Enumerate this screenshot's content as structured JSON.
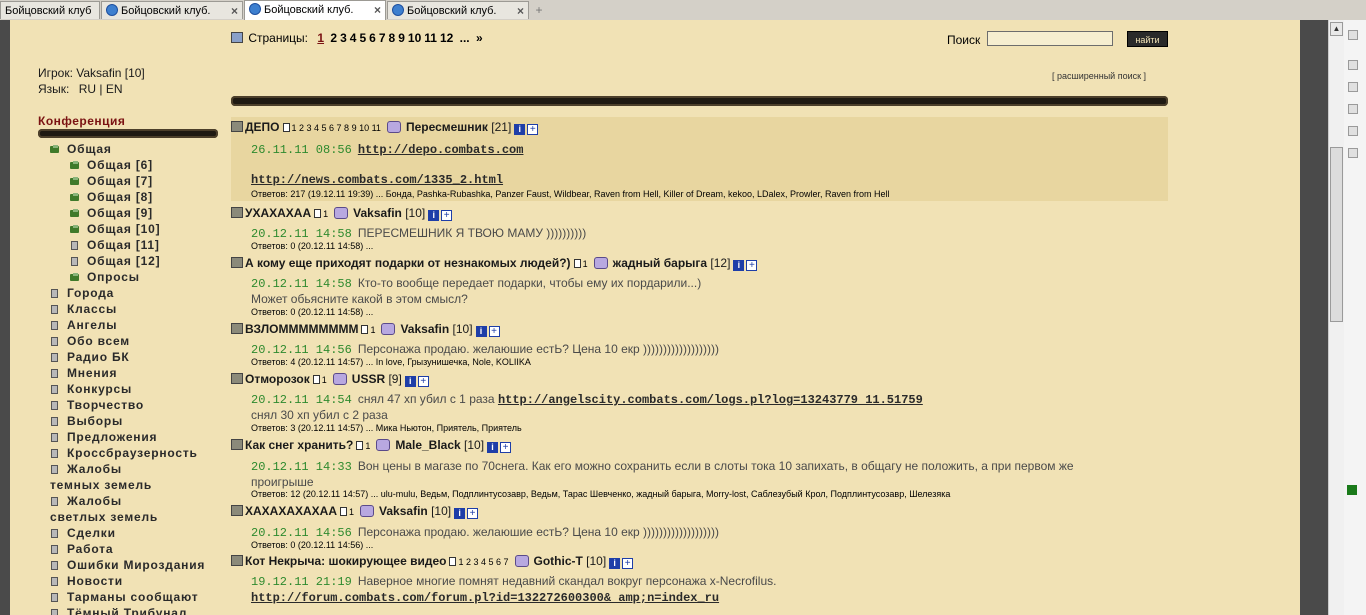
{
  "browser": {
    "tabs": [
      {
        "title": "Бойцовский клуб"
      },
      {
        "title": "Бойцовский клуб."
      },
      {
        "title": "Бойцовский клуб."
      },
      {
        "title": "Бойцовский клуб."
      }
    ],
    "new_tab": "+"
  },
  "player": {
    "label": "Игрок: Vaksafin [10]",
    "lang_label": "Язык:",
    "lang_ru": "RU",
    "lang_sep": "|",
    "lang_en": "EN"
  },
  "sidebar": {
    "title": "Конференция",
    "items": [
      {
        "label": "Общая",
        "icon": "folder-icon"
      },
      {
        "label": "Общая [6]",
        "icon": "folder-icon"
      },
      {
        "label": "Общая [7]",
        "icon": "folder-icon"
      },
      {
        "label": "Общая [8]",
        "icon": "folder-icon"
      },
      {
        "label": "Общая [9]",
        "icon": "folder-icon"
      },
      {
        "label": "Общая [10]",
        "icon": "folder-icon"
      },
      {
        "label": "Общая [11]",
        "icon": "scroll-icon"
      },
      {
        "label": "Общая [12]",
        "icon": "scroll-icon"
      },
      {
        "label": "Опросы",
        "icon": "folder-icon"
      },
      {
        "label": "Города",
        "icon": "scroll-icon"
      },
      {
        "label": "Классы",
        "icon": "scroll-icon"
      },
      {
        "label": "Ангелы",
        "icon": "scroll-icon"
      },
      {
        "label": "Обо всем",
        "icon": "scroll-icon"
      },
      {
        "label": "Радио БК",
        "icon": "scroll-icon"
      },
      {
        "label": "Мнения",
        "icon": "scroll-icon"
      },
      {
        "label": "Конкурсы",
        "icon": "scroll-icon"
      },
      {
        "label": "Творчество",
        "icon": "scroll-icon"
      },
      {
        "label": "Выборы",
        "icon": "scroll-icon"
      },
      {
        "label": "Предложения",
        "icon": "scroll-icon"
      },
      {
        "label": "Кроссбраузерность",
        "icon": "scroll-icon"
      },
      {
        "label": "Жалобы",
        "label2": "темных земель",
        "icon": "scroll-icon"
      },
      {
        "label": "Жалобы",
        "label2": "светлых земель",
        "icon": "scroll-icon"
      },
      {
        "label": "Сделки",
        "icon": "scroll-icon"
      },
      {
        "label": "Работа",
        "icon": "scroll-icon"
      },
      {
        "label": "Ошибки Мироздания",
        "icon": "scroll-icon"
      },
      {
        "label": "Новости",
        "icon": "scroll-icon"
      },
      {
        "label": "Тарманы сообщают",
        "icon": "scroll-icon"
      },
      {
        "label": "Тёмный Трибунал",
        "icon": "scroll-icon"
      }
    ]
  },
  "pager": {
    "label": "Страницы:",
    "current": "1",
    "pages": [
      "2",
      "3",
      "4",
      "5",
      "6",
      "7",
      "8",
      "9",
      "10",
      "11",
      "12"
    ],
    "more": "...",
    "next": "»"
  },
  "search": {
    "label": "Поиск",
    "button": "найти",
    "advanced": "[ расширенный поиск ]"
  },
  "topics": [
    {
      "title": "ДЕПО",
      "pages": "1 2 3 4 5 6 7 8 9 10 11",
      "author": "Пересмешник",
      "level": "[21]",
      "date": "26.11.11 08:56",
      "text": "http://depo.combats.com",
      "text2": "http://news.combats.com/1335_2.html",
      "replies": "Ответов: 217   (19.12.11 19:39) ... Бонда, Pashka-Rubashka, Panzer Faust, Wildbear, Raven from Hell, Killer of Dream, kekoo, LDalex, Prowler, Raven from Hell"
    },
    {
      "title": "УХАХАХАА",
      "pages": "1",
      "author": "Vaksafin",
      "level": "[10]",
      "date": "20.12.11 14:58",
      "text": "ПЕРЕСМЕШНИК Я ТВОЮ МАМУ ))))))))))",
      "replies": "Ответов: 0   (20.12.11 14:58) ..."
    },
    {
      "title": "А кому еще приходят подарки от незнакомых людей?)",
      "pages": "1",
      "author": "жадный барыга",
      "level": "[12]",
      "date": "20.12.11 14:58",
      "text": "Кто-то вообще передает подарки, чтобы ему их пордарили...)",
      "text2": "Может обьясните какой в этом смысл?",
      "replies": "Ответов: 0   (20.12.11 14:58) ..."
    },
    {
      "title": "ВЗЛОММММММММ",
      "pages": "1",
      "author": "Vaksafin",
      "level": "[10]",
      "date": "20.12.11 14:56",
      "text": "Персонажа продаю. желаюшие естЬ? Цена 10 екр )))))))))))))))))))",
      "replies": "Ответов: 4   (20.12.11 14:57) ... In love, Грызунишечка, Nole, KOLIIKA"
    },
    {
      "title": "Отморозок",
      "pages": "1",
      "author": "USSR",
      "level": "[9]",
      "date": "20.12.11 14:54",
      "text": "снял 47 хп убил с 1 раза",
      "link": "http://angelscity.combats.com/logs.pl?log=13243779 11.51759",
      "text2": "снял 30 хп убил с 2 раза",
      "replies": "Ответов: 3   (20.12.11 14:57) ... Мика Ньютон, Приятель, Приятель"
    },
    {
      "title": "Как снег хранить?",
      "pages": "1",
      "author": "Male_Black",
      "level": "[10]",
      "date": "20.12.11 14:33",
      "text": "Вон цены в магазе по 70снега. Как его можно сохранить если в слоты тока 10 запихать, в общагу не положить, а при первом же",
      "text2": "проигрыше",
      "replies": "Ответов: 12   (20.12.11 14:57) ... ulu-mulu, Ведьм, Подплинтусозавр, Ведьм, Тарас Шевченко, жадный барыга, Morry-lost, Саблезубый Крол, Подплинтусозавр, Шелезяка"
    },
    {
      "title": "ХАХАХАХАХАА",
      "pages": "1",
      "author": "Vaksafin",
      "level": "[10]",
      "date": "20.12.11 14:56",
      "text": "Персонажа продаю. желаюшие естЬ? Цена 10 екр )))))))))))))))))))",
      "replies": "Ответов: 0   (20.12.11 14:56) ..."
    },
    {
      "title": "Кот Некрыча: шокирующее видео",
      "pages": "1 2 3 4 5 6 7",
      "author": "Gothic-T",
      "level": "[10]",
      "date": "19.12.11 21:19",
      "text": "Наверное многие помнят недавний скандал вокруг персонажа x-Necrofilus.",
      "link2": "http://forum.combats.com/forum.pl?id=132272600300& amp;n=index_ru"
    }
  ]
}
